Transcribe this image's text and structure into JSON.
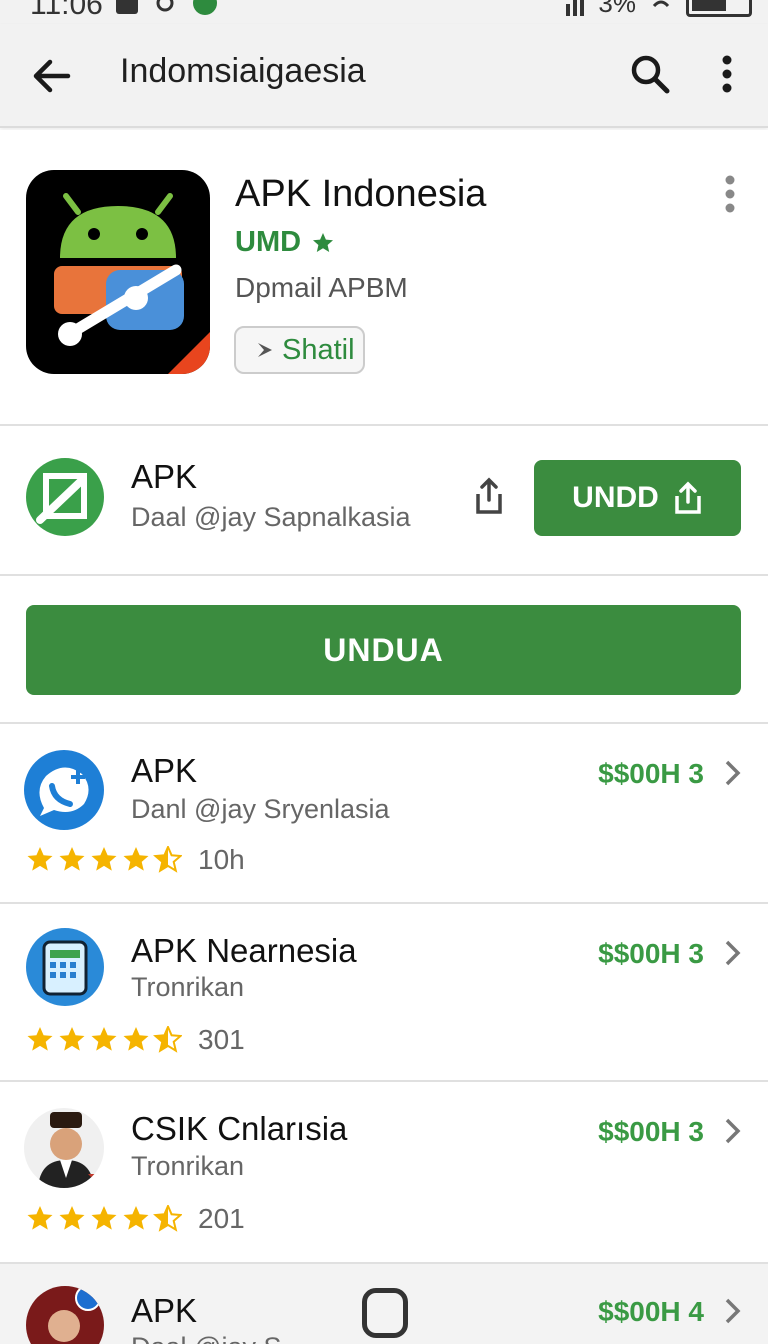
{
  "status_bar": {
    "time": "11:06",
    "battery_text": "3%"
  },
  "app_bar": {
    "title": "Indomsiaigaesia"
  },
  "hero": {
    "title": "APK Indonesia",
    "subtitle": "UMD",
    "developer": "Dpmail APBM",
    "chip_label": "Shatil"
  },
  "featured": {
    "title": "APK",
    "subtitle": "Daal @jay Sapnalkasia",
    "button_label": "UNDD"
  },
  "main_button_label": "UNDUA",
  "list": [
    {
      "title": "APK",
      "subtitle": "Danl @jay Sryenlasia",
      "price": "$$00H 3",
      "rating_count": "10h",
      "rating": 4.5
    },
    {
      "title": "APK Nearnesia",
      "subtitle": "Tronrikan",
      "price": "$$00H 3",
      "rating_count": "301",
      "rating": 4.5
    },
    {
      "title": "CSIK Cnlarısia",
      "subtitle": "Tronrikan",
      "price": "$$00H 3",
      "rating_count": "201",
      "rating": 4.5
    },
    {
      "title": "APK",
      "subtitle": "Daal @jay S",
      "price": "$$00H 4"
    }
  ],
  "colors": {
    "accent_green": "#3b8c3f",
    "price_green": "#3a9a44",
    "star_yellow": "#f5b400"
  },
  "icons": [
    "back-arrow-icon",
    "search-icon",
    "more-vert-icon",
    "share-icon",
    "upload-icon",
    "chevron-right-icon",
    "star-icon",
    "home-button-icon"
  ]
}
